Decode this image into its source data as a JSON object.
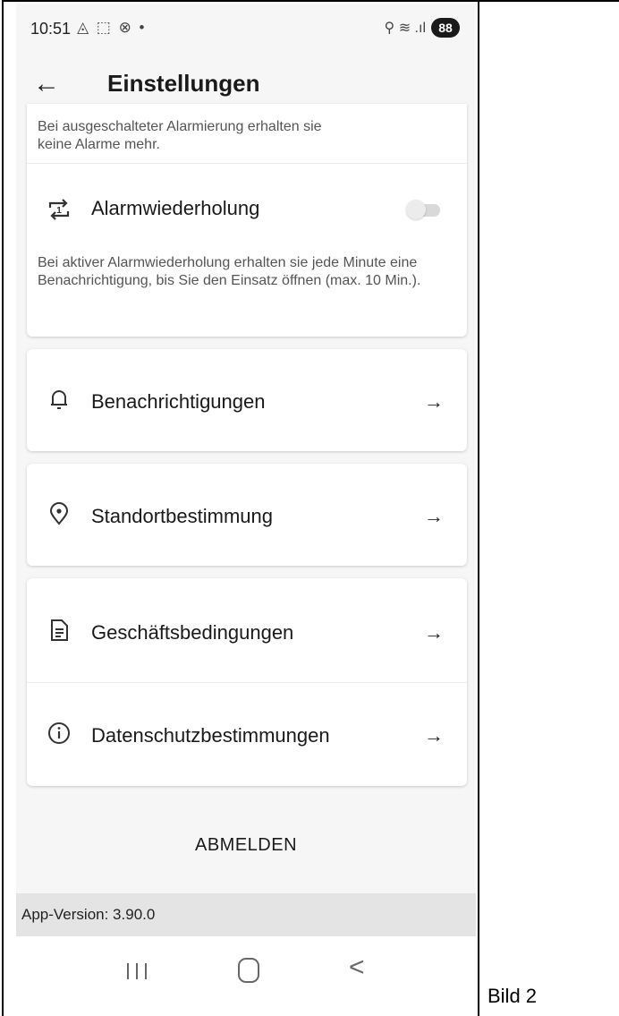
{
  "status_bar": {
    "time": "10:51",
    "left_icons": "◬ ⬚ ⊗ •",
    "right_icons": "⚲ ≋ .ıl",
    "battery": "88"
  },
  "app_bar": {
    "back_icon": "arrow-left-icon",
    "title": "Einstellungen"
  },
  "alarm_card": {
    "alarm_description": "Bei ausgeschalteter Alarmierung erhalten sie keine Alarme mehr.",
    "repeat": {
      "icon": "repeat-one-icon",
      "label": "Alarmwiederholung",
      "enabled": false,
      "description": "Bei aktiver Alarmwiederholung erhalten sie jede Minute eine Benachrichtigung, bis Sie den Einsatz öffnen (max. 10 Min.)."
    }
  },
  "menu": [
    {
      "icon": "bell-icon",
      "label": "Benachrichtigungen",
      "arrow": "→"
    },
    {
      "icon": "location-pin-icon",
      "label": "Standortbestimmung",
      "arrow": "→"
    },
    {
      "icon": "document-icon",
      "label": "Geschäftsbedingungen",
      "arrow": "→"
    },
    {
      "icon": "info-icon",
      "label": "Datenschutzbestimmungen",
      "arrow": "→"
    }
  ],
  "logout_label": "ABMELDEN",
  "version_text": "App-Version: 3.90.0",
  "system_nav": {
    "recent_icon": "recent-apps-icon",
    "home_icon": "home-icon",
    "back_icon": "chevron-left-icon",
    "back_glyph": "<"
  },
  "caption": "Bild 2",
  "colors": {
    "background": "#f6f6f6",
    "card": "#ffffff",
    "version_bar": "#e4e4e4",
    "text": "#1a1a1a"
  }
}
